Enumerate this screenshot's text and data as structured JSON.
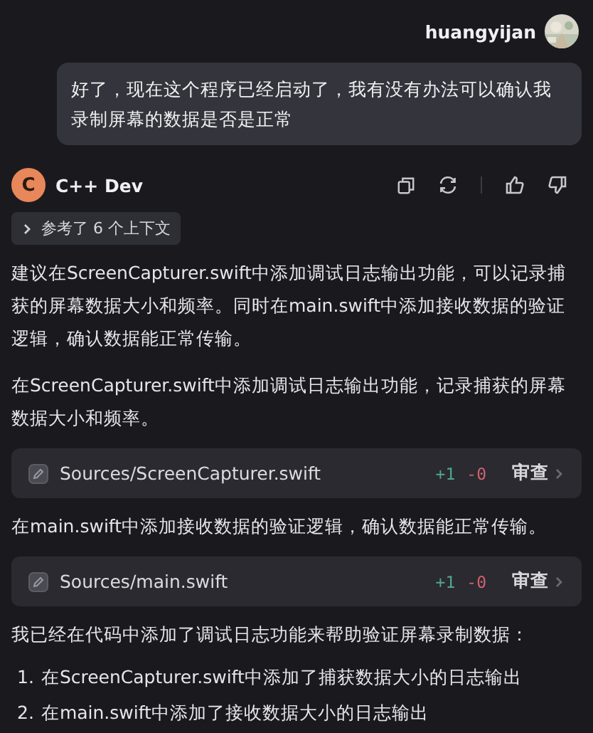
{
  "user_message": {
    "username": "huangyijan",
    "text": "好了，现在这个程序已经启动了，我有没有办法可以确认我录制屏幕的数据是否是正常"
  },
  "assistant": {
    "avatar_letter": "C",
    "name": "C++ Dev",
    "context": {
      "label": "参考了 6 个上下文",
      "expanded": false
    },
    "blocks": [
      {
        "kind": "text",
        "text": "建议在ScreenCapturer.swift中添加调试日志输出功能，可以记录捕获的屏幕数据大小和频率。同时在main.swift中添加接收数据的验证逻辑，确认数据能正常传输。"
      },
      {
        "kind": "text",
        "text": "在ScreenCapturer.swift中添加调试日志输出功能，记录捕获的屏幕数据大小和频率。"
      },
      {
        "kind": "file",
        "path": "Sources/ScreenCapturer.swift",
        "added": "+1",
        "removed": "-0",
        "action": "审查"
      },
      {
        "kind": "text",
        "text": "在main.swift中添加接收数据的验证逻辑，确认数据能正常传输。"
      },
      {
        "kind": "file",
        "path": "Sources/main.swift",
        "added": "+1",
        "removed": "-0",
        "action": "审查"
      },
      {
        "kind": "text",
        "text": "我已经在代码中添加了调试日志功能来帮助验证屏幕录制数据："
      },
      {
        "kind": "list",
        "items": [
          {
            "number": "1.",
            "text": "在ScreenCapturer.swift中添加了捕获数据大小的日志输出"
          },
          {
            "number": "2.",
            "text": "在main.swift中添加了接收数据大小的日志输出"
          }
        ]
      }
    ]
  }
}
